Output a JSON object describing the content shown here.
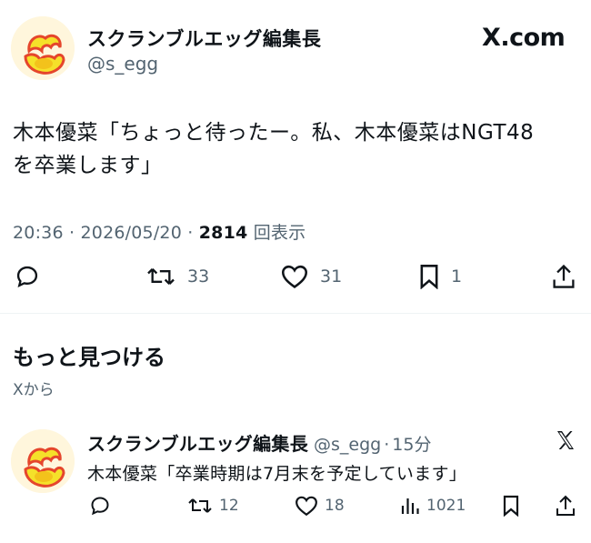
{
  "post": {
    "author_name": "スクランブルエッグ編集長",
    "author_handle": "@s_egg",
    "brand": "X.com",
    "text_line1": "木本優菜「ちょっと待ったー。私、木本優菜はNGT48",
    "text_line2": "を卒業します」",
    "time": "20:36",
    "date": "2026/05/20",
    "views_count": "2814",
    "views_label": "回表示",
    "replies_icon": "reply-icon",
    "retweets": "33",
    "likes": "31",
    "bookmarks": "1"
  },
  "more": {
    "title": "もっと見つける",
    "subtitle": "Xから"
  },
  "related": {
    "author_name": "スクランブルエッグ編集長",
    "author_handle": "@s_egg",
    "separator": "·",
    "age": "15分",
    "text": "木本優菜「卒業時期は7月末を予定しています」",
    "retweets": "12",
    "likes": "18",
    "views": "1021"
  },
  "colors": {
    "text": "#0f1419",
    "secondary": "#536471",
    "divider": "#eff3f4",
    "avatar_egg_yolk": "#f5e12a",
    "avatar_egg_outline": "#e5462c"
  }
}
